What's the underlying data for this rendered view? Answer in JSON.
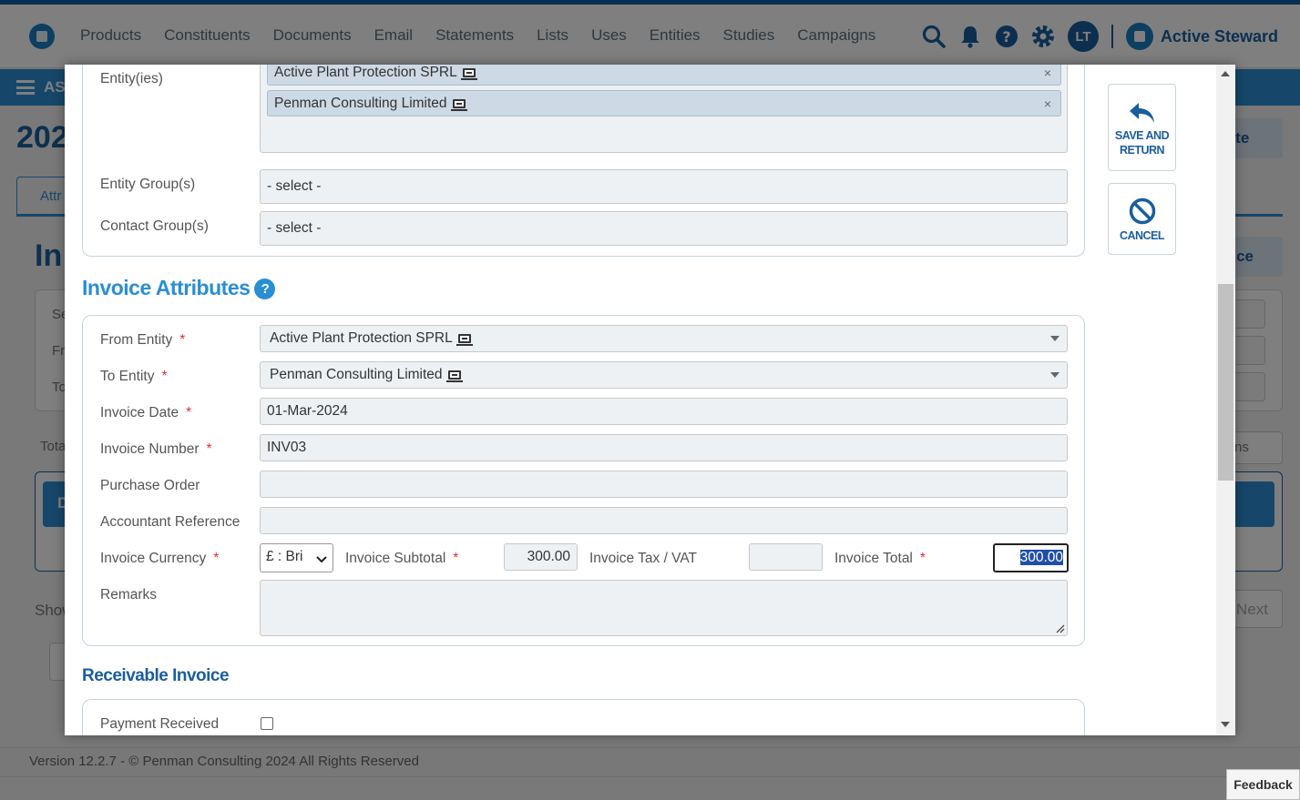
{
  "nav": {
    "items": [
      "Products",
      "Constituents",
      "Documents",
      "Email",
      "Statements",
      "Lists",
      "Uses",
      "Entities",
      "Studies",
      "Campaigns"
    ],
    "avatar_initials": "LT",
    "brand": "Active Steward"
  },
  "background": {
    "breadcrumb": "AS",
    "page_title": "202",
    "tab_label": "Attr",
    "section_title": "In",
    "delete_label": "lete",
    "invoice_btn_label": "oice",
    "filter_labels": [
      "Se",
      "Fr",
      "To"
    ],
    "total_label": "Tota",
    "columns_label": "ns",
    "table_head": "D",
    "show_label": "Show",
    "next_label": "Next"
  },
  "footer": {
    "version": "Version 12.2.7 - © Penman Consulting 2024 All Rights Reserved",
    "feedback": "Feedback"
  },
  "modal": {
    "entities": {
      "label": "Entity(ies)",
      "tags": [
        "Active Plant Protection SPRL",
        "Penman Consulting Limited"
      ],
      "remove_glyph": "×"
    },
    "entity_groups": {
      "label": "Entity Group(s)",
      "placeholder": "- select -"
    },
    "contact_groups": {
      "label": "Contact Group(s)",
      "placeholder": "- select -"
    },
    "invoice_attributes": {
      "title": "Invoice Attributes",
      "help_glyph": "?",
      "from_entity": {
        "label": "From Entity",
        "value": "Active Plant Protection SPRL"
      },
      "to_entity": {
        "label": "To Entity",
        "value": "Penman Consulting Limited"
      },
      "invoice_date": {
        "label": "Invoice Date",
        "value": "01-Mar-2024"
      },
      "invoice_number": {
        "label": "Invoice Number",
        "value": "INV03"
      },
      "purchase_order": {
        "label": "Purchase Order",
        "value": ""
      },
      "accountant_reference": {
        "label": "Accountant Reference",
        "value": ""
      },
      "invoice_currency": {
        "label": "Invoice Currency",
        "value": "£ : Bri"
      },
      "invoice_subtotal": {
        "label": "Invoice Subtotal",
        "value": "300.00"
      },
      "invoice_tax": {
        "label": "Invoice Tax / VAT",
        "value": ""
      },
      "invoice_total": {
        "label": "Invoice Total",
        "value": "300.00"
      },
      "remarks": {
        "label": "Remarks",
        "value": ""
      },
      "required_mark": "*"
    },
    "receivable": {
      "title": "Receivable Invoice",
      "payment_received": {
        "label": "Payment Received",
        "checked": false
      }
    },
    "actions": {
      "save_line1": "SAVE AND",
      "save_line2": "RETURN",
      "cancel": "CANCEL"
    }
  },
  "colors": {
    "accent": "#2a8ed3",
    "brand": "#1a5e9e",
    "required": "#dd3333",
    "tag_bg": "#cdd9e5"
  }
}
